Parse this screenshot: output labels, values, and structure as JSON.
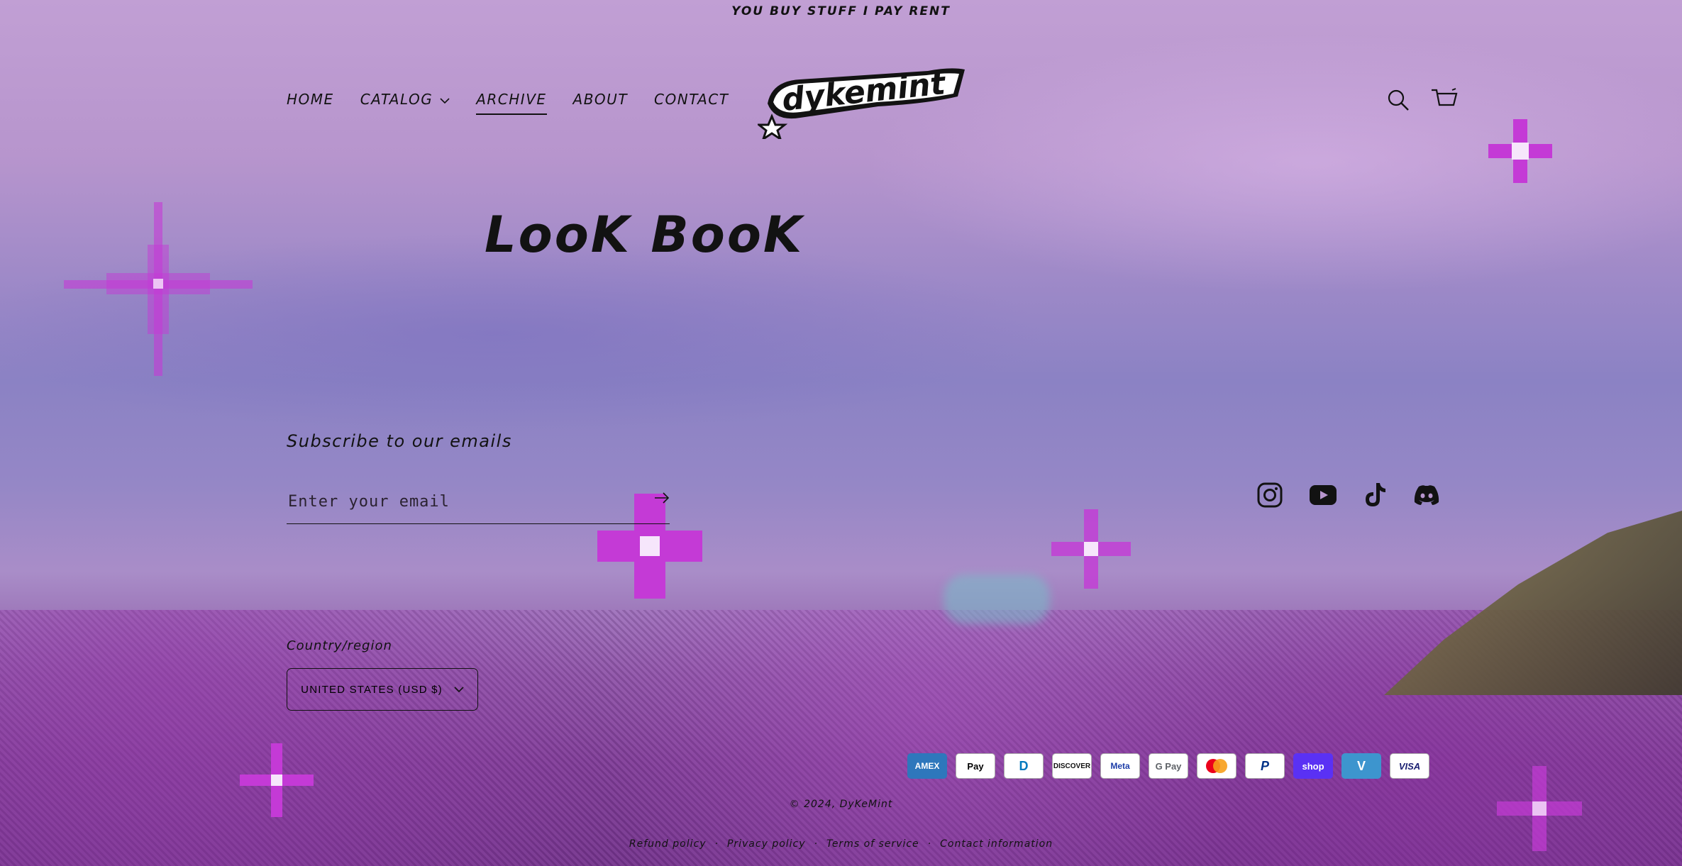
{
  "announcement": "YOU BUY STUFF I PAY RENT",
  "header": {
    "logo_text": "dykemint",
    "nav": [
      {
        "label": "HOME"
      },
      {
        "label": "CATALOG"
      },
      {
        "label": "ARCHIVE"
      },
      {
        "label": "ABOUT"
      },
      {
        "label": "CONTACT"
      }
    ],
    "icons": [
      "search-icon",
      "cart-icon"
    ]
  },
  "main": {
    "title": "LooK BooK"
  },
  "footer": {
    "newsletter_heading": "Subscribe to our emails",
    "email_placeholder": "Enter your email",
    "social": [
      "instagram-icon",
      "youtube-icon",
      "tiktok-icon",
      "discord-icon"
    ],
    "country_label": "Country/region",
    "country_value": "UNITED STATES (USD $)",
    "payments": {
      "amex": "AMEX",
      "applepay": "Pay",
      "diners": "D",
      "discover": "DISCOVER",
      "meta": "Meta",
      "gpay": "G Pay",
      "mastercard": "",
      "paypal": "P",
      "shoppay": "shop",
      "venmo": "V",
      "visa": "VISA"
    },
    "copyright": "© 2024, DyKeMint",
    "policies": {
      "refund": "Refund policy",
      "privacy": "Privacy policy",
      "terms": "Terms of service",
      "contact": "Contact information"
    }
  },
  "colors": {
    "text": "#121212",
    "sparkle": "#c43ad6",
    "sky_top": "#c19fd4",
    "flowers": "#7c3f93"
  }
}
